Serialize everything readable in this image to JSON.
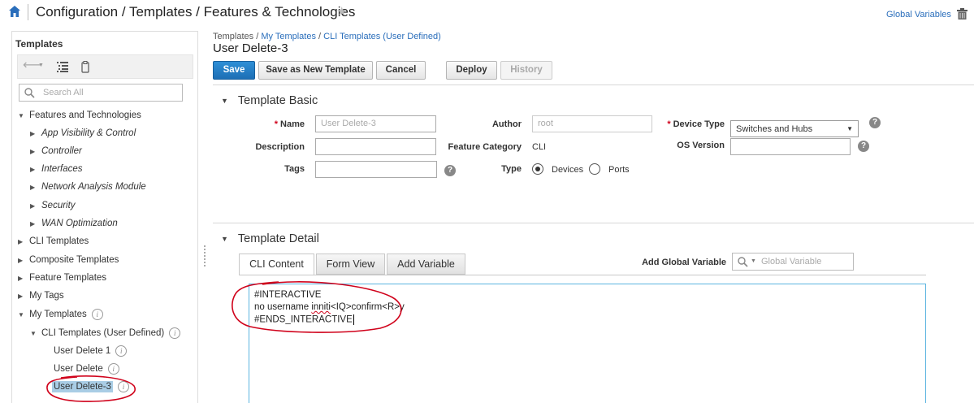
{
  "header": {
    "title": "Configuration / Templates / Features & Technologies",
    "global_variables_link": "Global Variables"
  },
  "sidebar": {
    "title": "Templates",
    "search_placeholder": "Search All",
    "tree": [
      {
        "label": "Features and Technologies",
        "state": "expanded"
      },
      {
        "label": "App Visibility & Control",
        "state": "collapsed"
      },
      {
        "label": "Controller",
        "state": "collapsed"
      },
      {
        "label": "Interfaces",
        "state": "collapsed"
      },
      {
        "label": "Network Analysis Module",
        "state": "collapsed"
      },
      {
        "label": "Security",
        "state": "collapsed"
      },
      {
        "label": "WAN Optimization",
        "state": "collapsed"
      },
      {
        "label": "CLI Templates",
        "state": "collapsed"
      },
      {
        "label": "Composite Templates",
        "state": "collapsed"
      },
      {
        "label": "Feature Templates",
        "state": "collapsed"
      },
      {
        "label": "My Tags",
        "state": "collapsed"
      },
      {
        "label": "My Templates",
        "state": "expanded"
      },
      {
        "label": "CLI Templates (User Defined)",
        "state": "expanded"
      },
      {
        "label": "User Delete 1",
        "state": "leaf"
      },
      {
        "label": "User Delete",
        "state": "leaf"
      },
      {
        "label": "User Delete-3",
        "state": "selected"
      }
    ]
  },
  "breadcrumb": {
    "root": "Templates",
    "sep": " / ",
    "level1": "My Templates",
    "level2": "CLI Templates (User Defined)"
  },
  "template_name": "User Delete-3",
  "toolbar": {
    "save": "Save",
    "save_as_new": "Save as New Template",
    "cancel": "Cancel",
    "deploy": "Deploy",
    "history": "History"
  },
  "template_basic": {
    "heading": "Template Basic",
    "name_label": "Name",
    "name_placeholder": "User Delete-3",
    "description_label": "Description",
    "tags_label": "Tags",
    "author_label": "Author",
    "author_value": "root",
    "feature_category_label": "Feature Category",
    "feature_category_value": "CLI",
    "type_label": "Type",
    "type_options": [
      "Devices",
      "Ports"
    ],
    "type_selected": "Devices",
    "device_type_label": "Device Type",
    "device_type_value": "Switches and Hubs",
    "os_version_label": "OS Version"
  },
  "template_detail": {
    "heading": "Template Detail",
    "tabs": [
      "CLI Content",
      "Form View",
      "Add Variable"
    ],
    "active_tab": "CLI Content",
    "add_global_variable_label": "Add Global Variable",
    "global_variable_placeholder": "Global Variable",
    "cli_line1": "#INTERACTIVE",
    "cli_line2_prefix": "no username ",
    "cli_line2_word": "inniti",
    "cli_line2_suffix": "<IQ>confirm<R>y",
    "cli_line3": "#ENDS_INTERACTIVE"
  },
  "icon_help": "?",
  "icon_info": "i",
  "colors": {
    "accent": "#1d6fb5",
    "link": "#2a6ebb",
    "annotation": "#d0021b",
    "selection": "#a9cde5"
  }
}
